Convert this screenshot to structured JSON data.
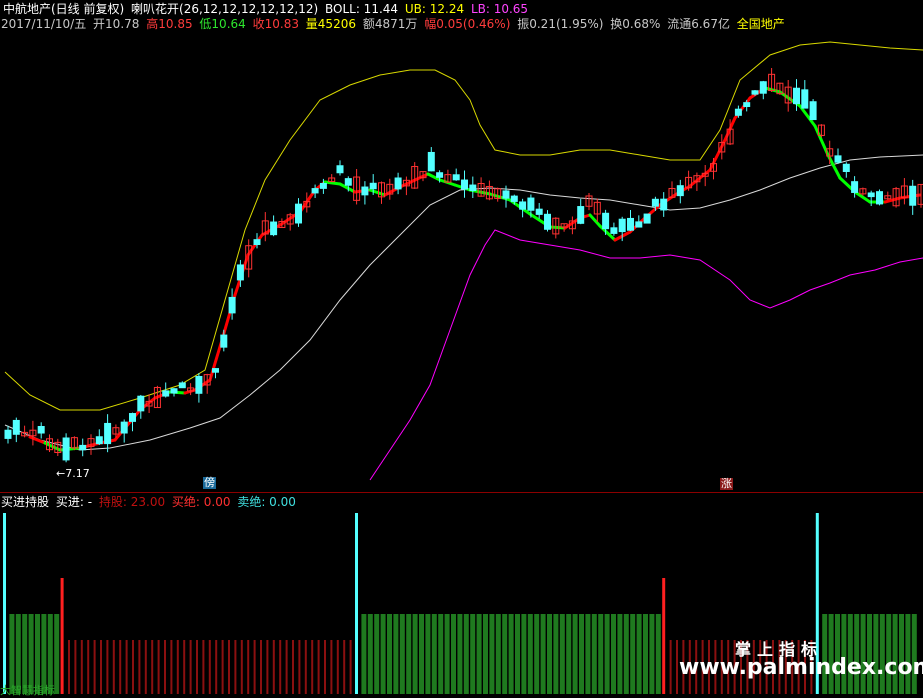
{
  "header1": {
    "stock": "中航地产(日线 前复权)",
    "indicator": "喇叭花开(26,12,12,12,12,12,12)",
    "boll": "BOLL: 11.44",
    "ub": "UB: 12.24",
    "lb": "LB: 10.65"
  },
  "header2": {
    "date": "2017/11/10/五",
    "open": "开10.78",
    "high": "高10.85",
    "low": "低10.64",
    "close": "收10.83",
    "volume": "量45206",
    "amount": "额4871万",
    "change": "幅0.05(0.46%)",
    "amplitude": "振0.21(1.95%)",
    "turnover": "换0.68%",
    "float_cap": "流通6.67亿",
    "sector": "全国地产"
  },
  "low_annotation": "←7.17",
  "markers": {
    "left": "傍",
    "right": "涨"
  },
  "panel": {
    "title": "买进持股",
    "buy": "买进: -",
    "hold": "持股: 23.00",
    "buy_cut": "买绝: 0.00",
    "sell_cut": "卖绝: 0.00"
  },
  "watermark": {
    "cn": "掌上指标",
    "url": "www.palmindex.com"
  },
  "bottom_label": "大智慧指标",
  "colors": {
    "up": "#ff3232",
    "down": "#54ffff",
    "ub_line": "#ffff00",
    "mid_line": "#ffffff",
    "lb_line": "#ff00ff",
    "trend_up": "#ff0000",
    "trend_down": "#00ff00",
    "bar_hold": "#1f7a1f",
    "bar_wait": "#8b1010",
    "signal_buy": "#54ffff",
    "signal_sell": "#ff2020"
  },
  "chart_data": {
    "type": "candlestick",
    "low_price": 7.17,
    "boll_last": 11.44,
    "ub_last": 12.24,
    "lb_last": 10.65,
    "buy_signal_bars": [
      0,
      55,
      127
    ],
    "sell_signal_bars": [
      9,
      103,
      143
    ]
  }
}
